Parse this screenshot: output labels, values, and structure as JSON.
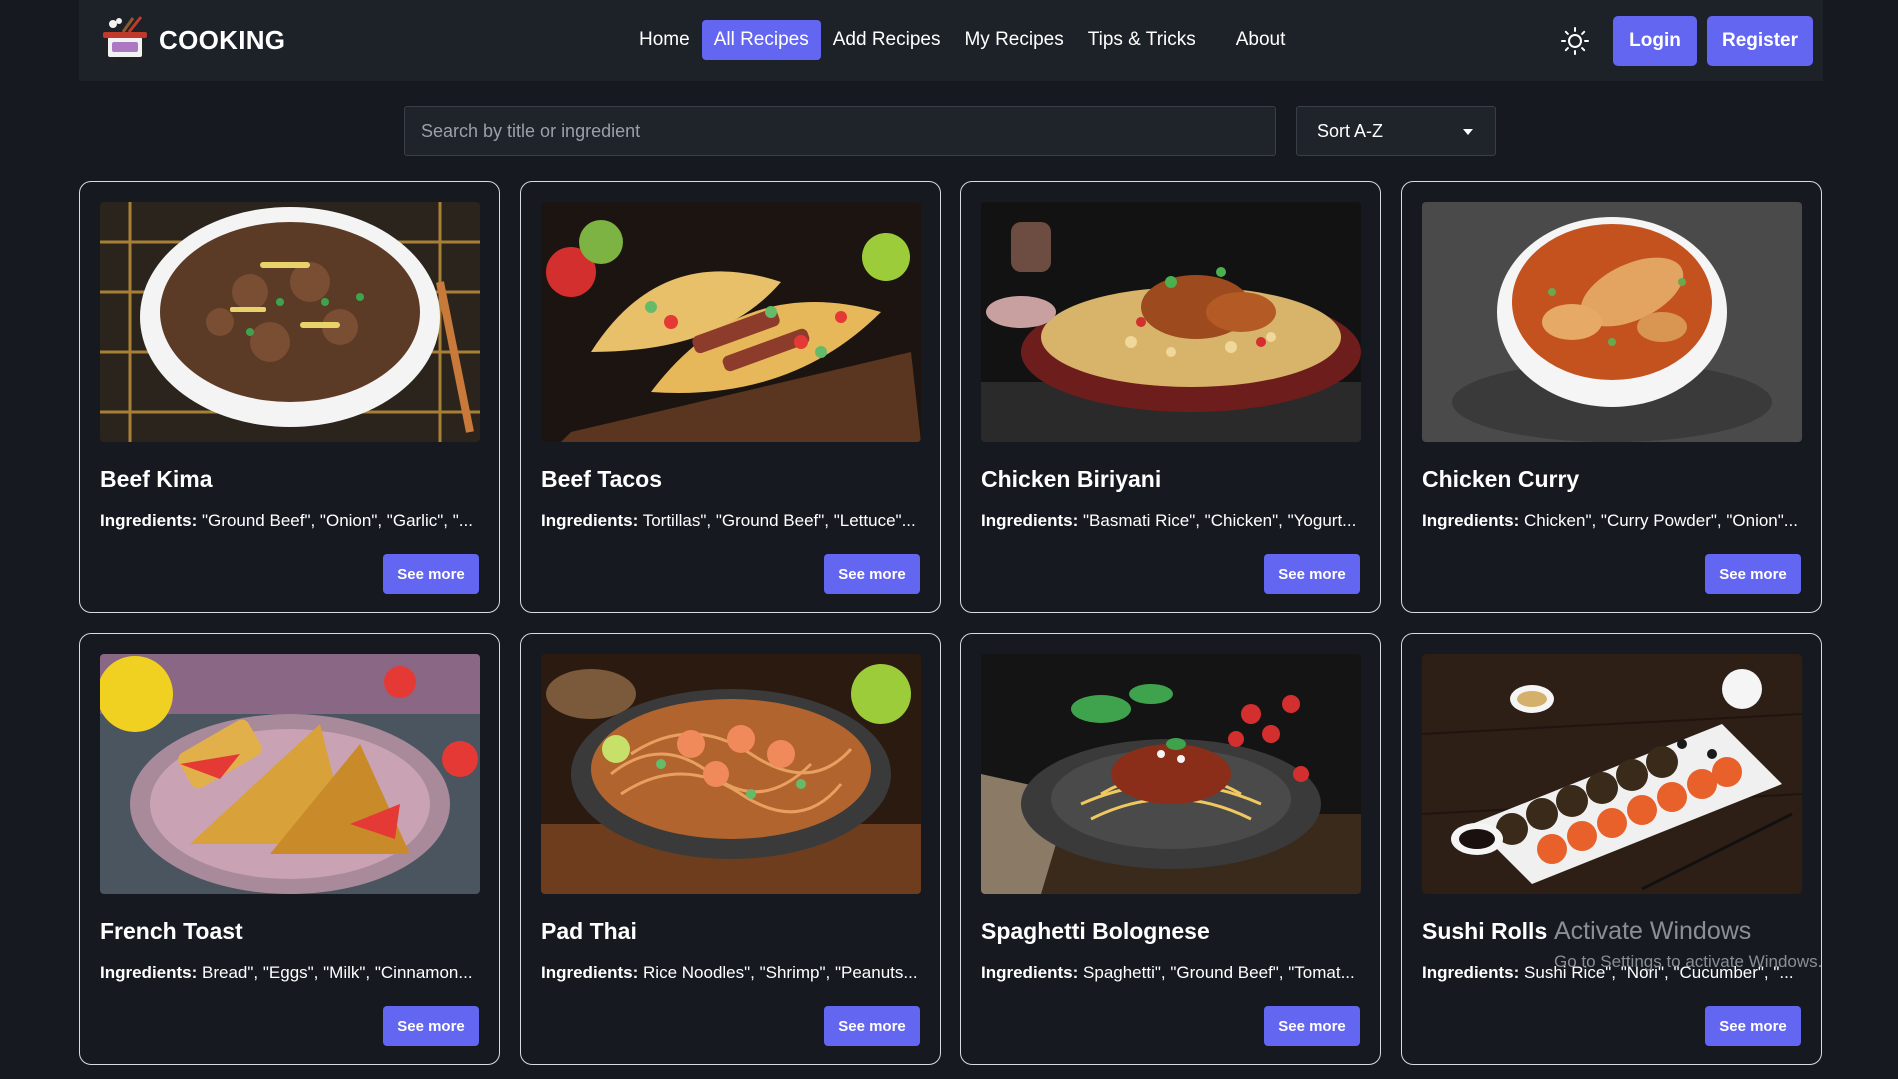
{
  "brand": {
    "name": "COOKING",
    "logo_icon": "cooking-pot-icon"
  },
  "nav": {
    "home": "Home",
    "all_recipes": "All Recipes",
    "add_recipes": "Add Recipes",
    "my_recipes": "My Recipes",
    "tips": "Tips & Tricks",
    "about": "About"
  },
  "header": {
    "theme_icon": "sun-icon",
    "login": "Login",
    "register": "Register"
  },
  "search": {
    "placeholder": "Search by title or ingredient",
    "value": ""
  },
  "sort": {
    "selected": "Sort A-Z"
  },
  "ingredients_label": "Ingredients:",
  "see_more_label": "See more",
  "recipes": [
    {
      "title": "Beef Kima",
      "ingredients": " \"Ground Beef\", \"Onion\", \"Garlic\", \"..."
    },
    {
      "title": "Beef Tacos",
      "ingredients": " Tortillas\", \"Ground Beef\", \"Lettuce\"..."
    },
    {
      "title": "Chicken Biriyani",
      "ingredients": " \"Basmati Rice\", \"Chicken\", \"Yogurt..."
    },
    {
      "title": "Chicken Curry",
      "ingredients": " Chicken\", \"Curry Powder\", \"Onion\"..."
    },
    {
      "title": "French Toast",
      "ingredients": " Bread\", \"Eggs\", \"Milk\", \"Cinnamon..."
    },
    {
      "title": "Pad Thai",
      "ingredients": " Rice Noodles\", \"Shrimp\", \"Peanuts..."
    },
    {
      "title": "Spaghetti Bolognese",
      "ingredients": " Spaghetti\", \"Ground Beef\", \"Tomat..."
    },
    {
      "title": "Sushi Rolls",
      "ingredients": " Sushi Rice\", \"Nori\", \"Cucumber\", \"..."
    }
  ],
  "watermark": {
    "title": "Activate Windows",
    "subtitle": "Go to Settings to activate Windows."
  },
  "colors": {
    "accent": "#6366f1",
    "background": "#161a20",
    "navbar": "#1d2128",
    "card_border": "#d8dbe0"
  }
}
